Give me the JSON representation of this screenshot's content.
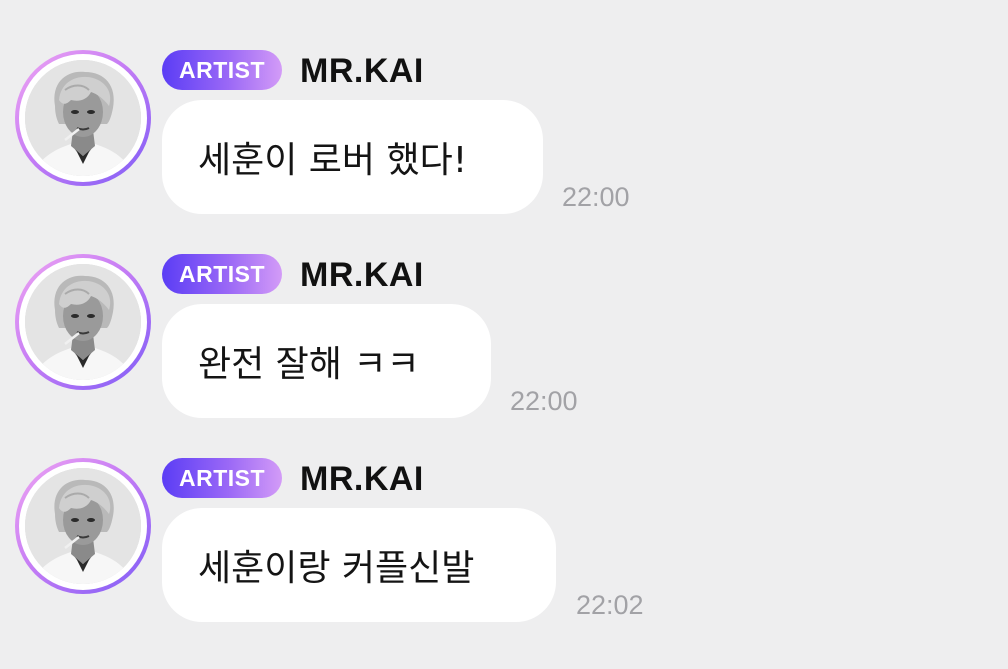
{
  "messages": [
    {
      "badge": "ARTIST",
      "sender": "MR.KAI",
      "text": "세훈이 로버 했다!",
      "time": "22:00"
    },
    {
      "badge": "ARTIST",
      "sender": "MR.KAI",
      "text": "완전 잘해 ㅋㅋ",
      "time": "22:00"
    },
    {
      "badge": "ARTIST",
      "sender": "MR.KAI",
      "text": "세훈이랑 커플신발",
      "time": "22:02"
    }
  ],
  "colors": {
    "background": "#eeeeef",
    "bubble": "#ffffff",
    "badge_start": "#5b3df5",
    "badge_end": "#d39bf7",
    "ring_start": "#f0a6f2",
    "ring_end": "#7d5cf6",
    "timestamp": "#a2a2a6"
  }
}
